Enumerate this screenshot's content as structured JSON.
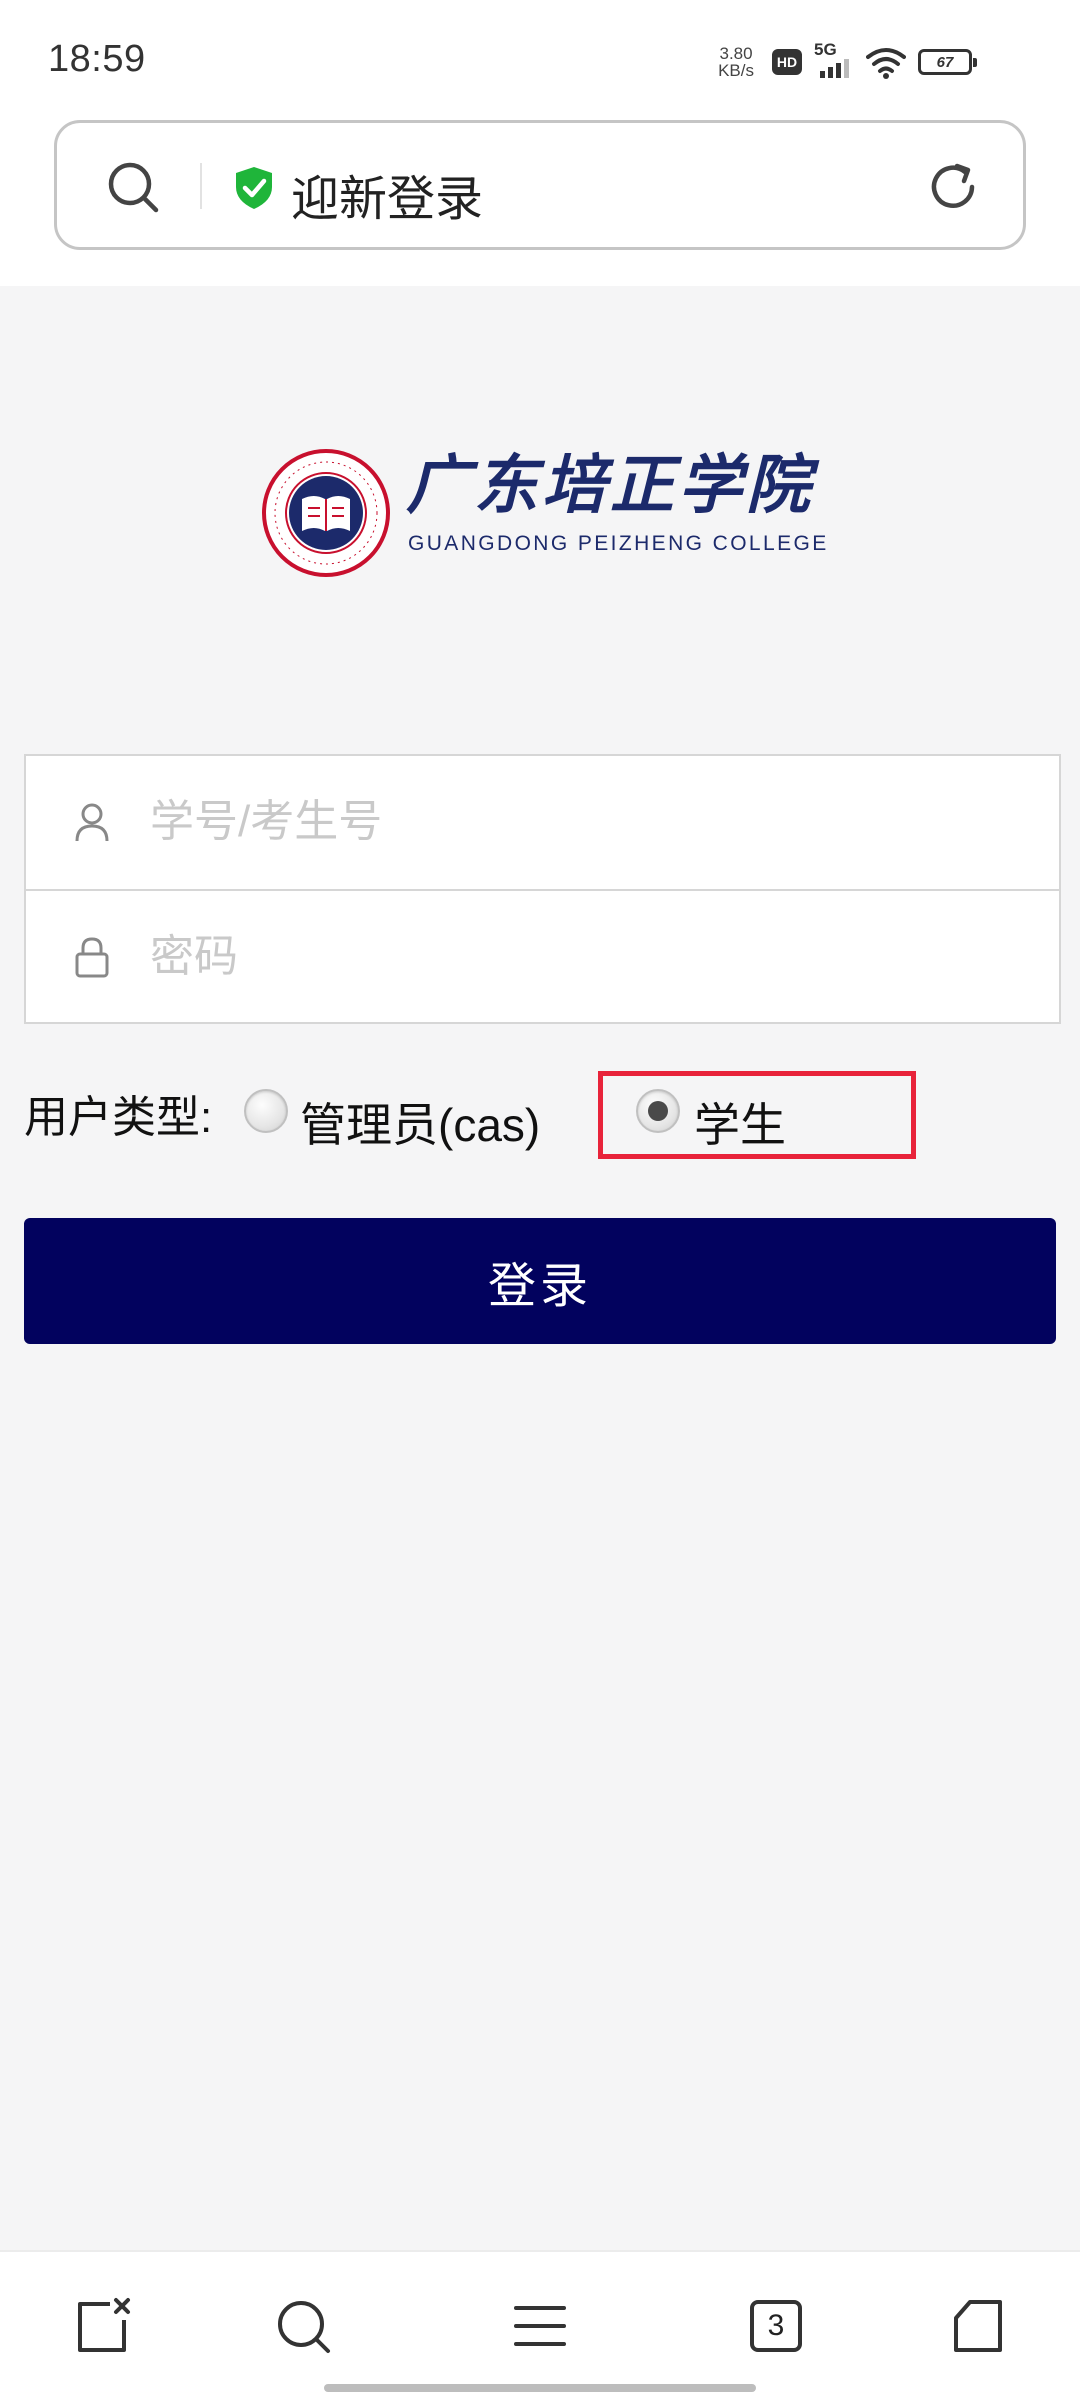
{
  "status_bar": {
    "time": "18:59",
    "net_speed_value": "3.80",
    "net_speed_unit": "KB/s",
    "hd_badge": "HD",
    "signal_label": "5G",
    "battery_level": "67"
  },
  "address_bar": {
    "title": "迎新登录",
    "icons": [
      "search-icon",
      "shield-check-icon",
      "refresh-icon"
    ],
    "shield_color": "#1fb53a"
  },
  "logo": {
    "name_cn": "广东培正学院",
    "name_en": "GUANGDONG  PEIZHENG  COLLEGE",
    "seal_ring_text": "GUANGDONG PEI ZHENG COLLEGE",
    "brand_color": "#1c2a6b",
    "seal_color": "#c8102e"
  },
  "form": {
    "username_placeholder": "学号/考生号",
    "username_value": "",
    "password_placeholder": "密码",
    "password_value": "",
    "user_type_label": "用户类型:",
    "options": [
      {
        "label": "管理员(cas)",
        "selected": false
      },
      {
        "label": "学生",
        "selected": true
      }
    ],
    "highlight_color": "#e8233a",
    "login_button": "登录",
    "login_button_color": "#02025e"
  },
  "bottom_nav": {
    "items": [
      "close-tab-icon",
      "search-icon",
      "menu-icon",
      "tabs-icon",
      "home-icon"
    ],
    "tab_count": "3"
  }
}
